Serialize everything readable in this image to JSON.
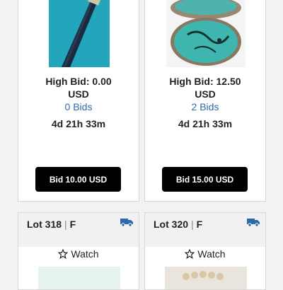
{
  "lots": [
    {
      "high_bid": "High Bid: 0.00",
      "currency": "USD",
      "bids": "0 Bids",
      "time_left": "4d 21h 33m",
      "bid_button": "Bid 10.00 USD",
      "icon": "walking-cane-image"
    },
    {
      "high_bid": "High Bid: 12.50",
      "currency": "USD",
      "bids": "2 Bids",
      "time_left": "4d 21h 33m",
      "bid_button": "Bid 15.00 USD",
      "icon": "turquoise-jewelry-image"
    }
  ],
  "next_lots": [
    {
      "lot": "Lot 318",
      "flag": "F",
      "watch": "Watch",
      "shipping_icon": "truck-icon",
      "watch_icon": "star-icon"
    },
    {
      "lot": "Lot 320",
      "flag": "F",
      "watch": "Watch",
      "shipping_icon": "truck-icon",
      "watch_icon": "star-icon"
    }
  ],
  "colors": {
    "accent": "#2e6aa8",
    "button": "#000000",
    "truck": "#2e6aa8"
  }
}
